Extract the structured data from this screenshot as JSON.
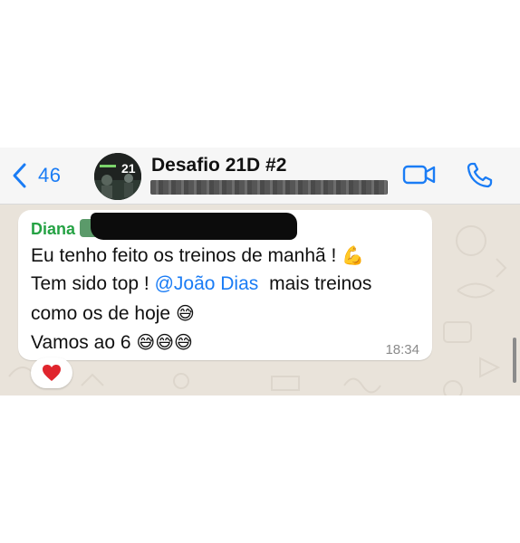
{
  "header": {
    "back_count": "46",
    "group_name": "Desafio 21D #2",
    "avatar_text": "21"
  },
  "message": {
    "sender": "Diana",
    "line1": "Eu tenho feito os treinos de manhã !",
    "line1_emoji": "💪",
    "line2_pre": "Tem sido top !",
    "mention": "@João Dias",
    "line2_post": "mais treinos",
    "line3": "como os de hoje",
    "line3_emoji": "😅",
    "line4": "Vamos ao 6",
    "line4_emojis": "😅😅😅",
    "time": "18:34"
  },
  "reaction": {
    "emoji": "heart",
    "color": "#e0252d"
  },
  "colors": {
    "accent": "#1a7cf5",
    "sender": "#25a244",
    "chat_bg": "#e9e3da"
  }
}
